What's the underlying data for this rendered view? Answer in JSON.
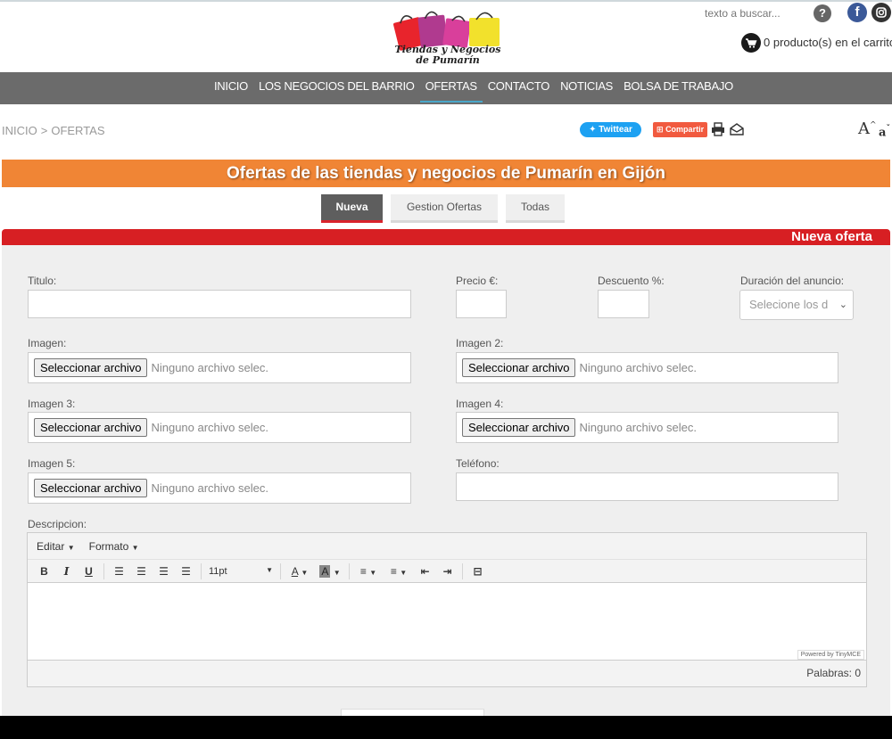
{
  "header": {
    "logo_line1": "Tiendas y Negocios",
    "logo_line2": "de Pumarín",
    "search_placeholder": "texto a buscar...",
    "help_icon": "?",
    "cart_text": "0 producto(s) en el carrito"
  },
  "nav": {
    "items": [
      {
        "label": "INICIO"
      },
      {
        "label": "LOS NEGOCIOS DEL BARRIO"
      },
      {
        "label": "OFERTAS"
      },
      {
        "label": "CONTACTO"
      },
      {
        "label": "NOTICIAS"
      },
      {
        "label": "BOLSA DE TRABAJO"
      }
    ]
  },
  "breadcrumb": {
    "home": "INICIO",
    "separator": ">",
    "current": "OFERTAS"
  },
  "share": {
    "twitter_label": "Twittear",
    "share_label": "Compartir",
    "font_increase": "A",
    "font_decrease": "a"
  },
  "banner_title": "Ofertas de las tiendas y negocios de Pumarín en Gijón",
  "tabs": [
    {
      "label": "Nueva"
    },
    {
      "label": "Gestion Ofertas"
    },
    {
      "label": "Todas"
    }
  ],
  "section_title": "Nueva oferta",
  "form": {
    "titulo_label": "Titulo:",
    "precio_label": "Precio €:",
    "descuento_label": "Descuento %:",
    "duracion_label": "Duración del anuncio:",
    "duracion_placeholder": "Selecione los d",
    "imagen_label": "Imagen:",
    "imagen2_label": "Imagen 2:",
    "imagen3_label": "Imagen 3:",
    "imagen4_label": "Imagen 4:",
    "imagen5_label": "Imagen 5:",
    "telefono_label": "Teléfono:",
    "file_button": "Seleccionar archivo",
    "file_status": "Ninguno archivo selec.",
    "descripcion_label": "Descripcion:"
  },
  "editor": {
    "menu": [
      {
        "label": "Editar"
      },
      {
        "label": "Formato"
      }
    ],
    "font_size": "11pt",
    "bold": "B",
    "italic": "I",
    "underline": "U",
    "text_color": "A",
    "bg_color": "A",
    "powered_by": "Powered by TinyMCE",
    "word_count": "Palabras: 0"
  },
  "colors": {
    "nav_bg": "#6b6b6b",
    "banner_bg": "#f08535",
    "section_bar": "#d71f23",
    "active_tab": "#5e5e5e",
    "twitter": "#1da1f2",
    "share": "#f15a3f"
  },
  "icons": [
    "help-icon",
    "facebook-icon",
    "instagram-icon",
    "cart-icon",
    "twitter-bird-icon",
    "print-icon",
    "mail-icon",
    "font-size-icon",
    "chevron-down-icon"
  ]
}
